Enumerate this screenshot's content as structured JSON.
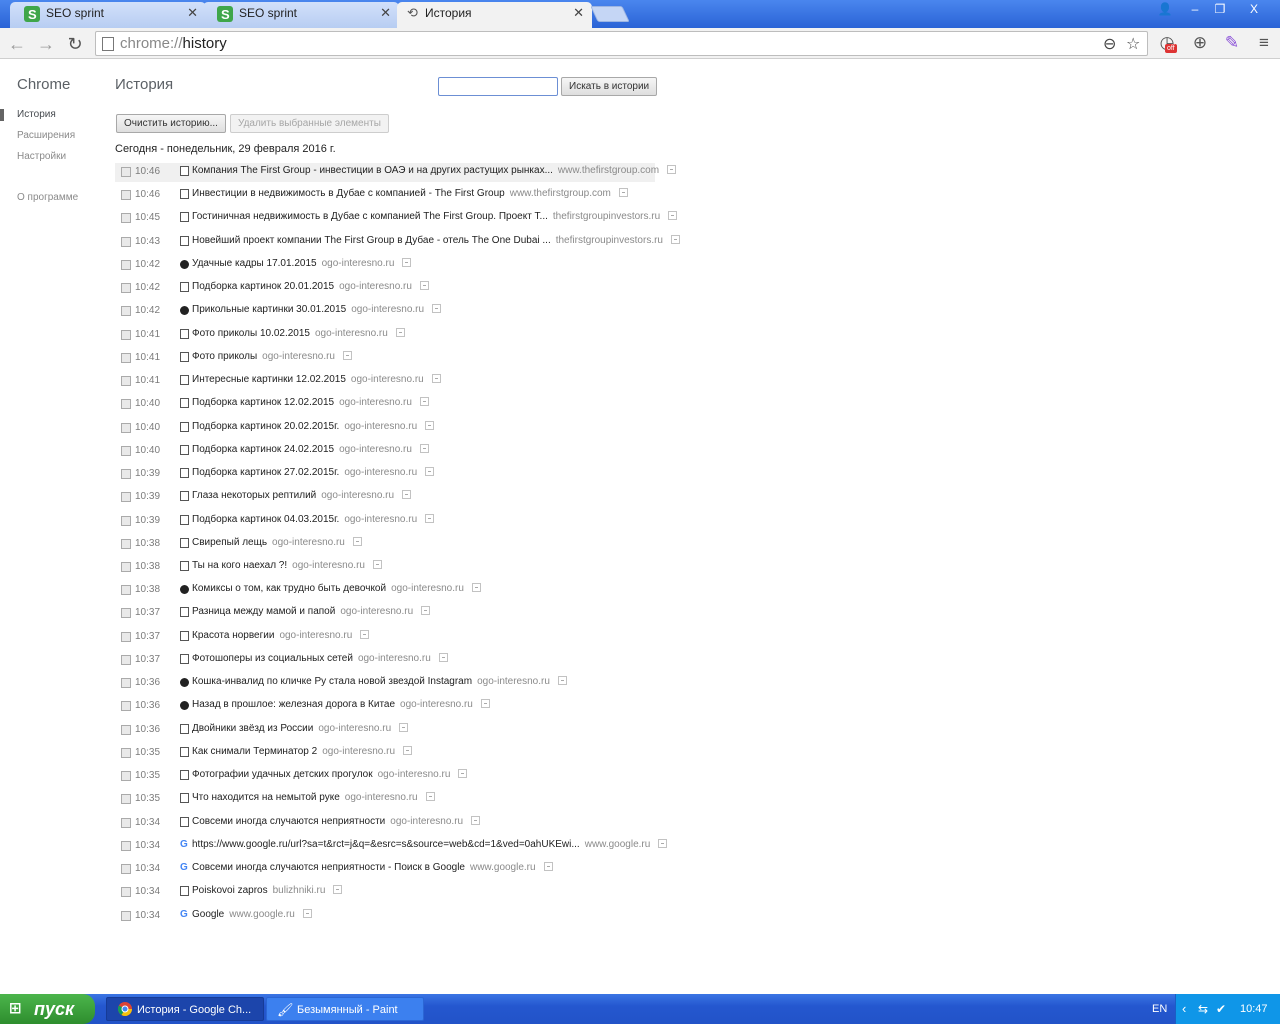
{
  "browser": {
    "tabs": [
      {
        "title": "SEO sprint",
        "icon": "seo-sprint-logo"
      },
      {
        "title": "SEO sprint",
        "icon": "seo-sprint-logo"
      },
      {
        "title": "История",
        "icon": "history-clock-icon"
      }
    ],
    "window_buttons": {
      "user": "👤",
      "minimize": "–",
      "maximize": "❐",
      "close": "X"
    },
    "url_scheme": "chrome://",
    "url_path": "history",
    "zoom_icon": "⊖",
    "star_icon": "☆",
    "ext_badge": "off"
  },
  "sidebar": {
    "brand": "Chrome",
    "items": [
      "История",
      "Расширения",
      "Настройки"
    ],
    "about": "О программе"
  },
  "main": {
    "title": "История",
    "search_button": "Искать в истории",
    "clear_button": "Очистить историю...",
    "remove_button": "Удалить выбранные элементы",
    "day_header": "Сегодня - понедельник, 29 февраля 2016 г."
  },
  "entries": [
    {
      "time": "10:46",
      "title": "Компания The First Group - инвестиции в ОАЭ и на других растущих рынках...",
      "domain": "www.thefirstgroup.com",
      "icon": "doc"
    },
    {
      "time": "10:46",
      "title": "Инвестиции в недвижимость в Дубае с компанией - The First Group",
      "domain": "www.thefirstgroup.com",
      "icon": "doc"
    },
    {
      "time": "10:45",
      "title": "Гостиничная недвижимость в Дубае с компанией The First Group. Проект Т...",
      "domain": "thefirstgroupinvestors.ru",
      "icon": "doc"
    },
    {
      "time": "10:43",
      "title": "Новейший проект компании The First Group в Дубае - отель The One Dubai ...",
      "domain": "thefirstgroupinvestors.ru",
      "icon": "doc"
    },
    {
      "time": "10:42",
      "title": "Удачные кадры 17.01.2015",
      "domain": "ogo-interesno.ru",
      "icon": "circ"
    },
    {
      "time": "10:42",
      "title": "Подборка картинок 20.01.2015",
      "domain": "ogo-interesno.ru",
      "icon": "doc"
    },
    {
      "time": "10:42",
      "title": "Прикольные картинки 30.01.2015",
      "domain": "ogo-interesno.ru",
      "icon": "circ"
    },
    {
      "time": "10:41",
      "title": "Фото приколы 10.02.2015",
      "domain": "ogo-interesno.ru",
      "icon": "doc"
    },
    {
      "time": "10:41",
      "title": "Фото приколы",
      "domain": "ogo-interesno.ru",
      "icon": "doc"
    },
    {
      "time": "10:41",
      "title": "Интересные картинки 12.02.2015",
      "domain": "ogo-interesno.ru",
      "icon": "doc"
    },
    {
      "time": "10:40",
      "title": "Подборка картинок 12.02.2015",
      "domain": "ogo-interesno.ru",
      "icon": "doc"
    },
    {
      "time": "10:40",
      "title": "Подборка картинок 20.02.2015г.",
      "domain": "ogo-interesno.ru",
      "icon": "doc"
    },
    {
      "time": "10:40",
      "title": "Подборка картинок 24.02.2015",
      "domain": "ogo-interesno.ru",
      "icon": "doc"
    },
    {
      "time": "10:39",
      "title": "Подборка картинок 27.02.2015г.",
      "domain": "ogo-interesno.ru",
      "icon": "doc"
    },
    {
      "time": "10:39",
      "title": "Глаза некоторых рептилий",
      "domain": "ogo-interesno.ru",
      "icon": "doc"
    },
    {
      "time": "10:39",
      "title": "Подборка картинок 04.03.2015г.",
      "domain": "ogo-interesno.ru",
      "icon": "doc"
    },
    {
      "time": "10:38",
      "title": "Свирепый лещь",
      "domain": "ogo-interesno.ru",
      "icon": "doc"
    },
    {
      "time": "10:38",
      "title": "Ты на кого наехал ?!",
      "domain": "ogo-interesno.ru",
      "icon": "doc"
    },
    {
      "time": "10:38",
      "title": "Комиксы о том, как трудно быть девочкой",
      "domain": "ogo-interesno.ru",
      "icon": "circ"
    },
    {
      "time": "10:37",
      "title": "Разница между мамой и папой",
      "domain": "ogo-interesno.ru",
      "icon": "doc"
    },
    {
      "time": "10:37",
      "title": "Красота норвегии",
      "domain": "ogo-interesno.ru",
      "icon": "doc"
    },
    {
      "time": "10:37",
      "title": "Фотошоперы из социальных сетей",
      "domain": "ogo-interesno.ru",
      "icon": "doc"
    },
    {
      "time": "10:36",
      "title": "Кошка-инвалид по кличке Ру стала новой звездой Instagram",
      "domain": "ogo-interesno.ru",
      "icon": "circ"
    },
    {
      "time": "10:36",
      "title": "Назад в прошлое: железная дорога в Китае",
      "domain": "ogo-interesno.ru",
      "icon": "circ"
    },
    {
      "time": "10:36",
      "title": "Двойники звёзд из России",
      "domain": "ogo-interesno.ru",
      "icon": "doc"
    },
    {
      "time": "10:35",
      "title": "Как снимали Терминатор 2",
      "domain": "ogo-interesno.ru",
      "icon": "doc"
    },
    {
      "time": "10:35",
      "title": "Фотографии удачных детских прогулок",
      "domain": "ogo-interesno.ru",
      "icon": "doc"
    },
    {
      "time": "10:35",
      "title": "Что находится на немытой руке",
      "domain": "ogo-interesno.ru",
      "icon": "doc"
    },
    {
      "time": "10:34",
      "title": "Совсеми иногда случаются неприятности",
      "domain": "ogo-interesno.ru",
      "icon": "doc"
    },
    {
      "time": "10:34",
      "title": "https://www.google.ru/url?sa=t&rct=j&q=&esrc=s&source=web&cd=1&ved=0ahUKEwi...",
      "domain": "www.google.ru",
      "icon": "g"
    },
    {
      "time": "10:34",
      "title": "Совсеми иногда случаются неприятности - Поиск в Google",
      "domain": "www.google.ru",
      "icon": "g"
    },
    {
      "time": "10:34",
      "title": "Poiskovoi zapros",
      "domain": "bulizhniki.ru",
      "icon": "doc"
    },
    {
      "time": "10:34",
      "title": "Google",
      "domain": "www.google.ru",
      "icon": "g"
    }
  ],
  "taskbar": {
    "start": "пуск",
    "items": [
      {
        "title": "История - Google Ch...",
        "icon": "chrome-icon"
      },
      {
        "title": "Безымянный - Paint",
        "icon": "paint-icon"
      }
    ],
    "lang": "EN",
    "clock": "10:47"
  },
  "colors": {
    "accent": "#2a63d6",
    "taskbar": "#2457cf",
    "start": "#3a9e3a"
  }
}
